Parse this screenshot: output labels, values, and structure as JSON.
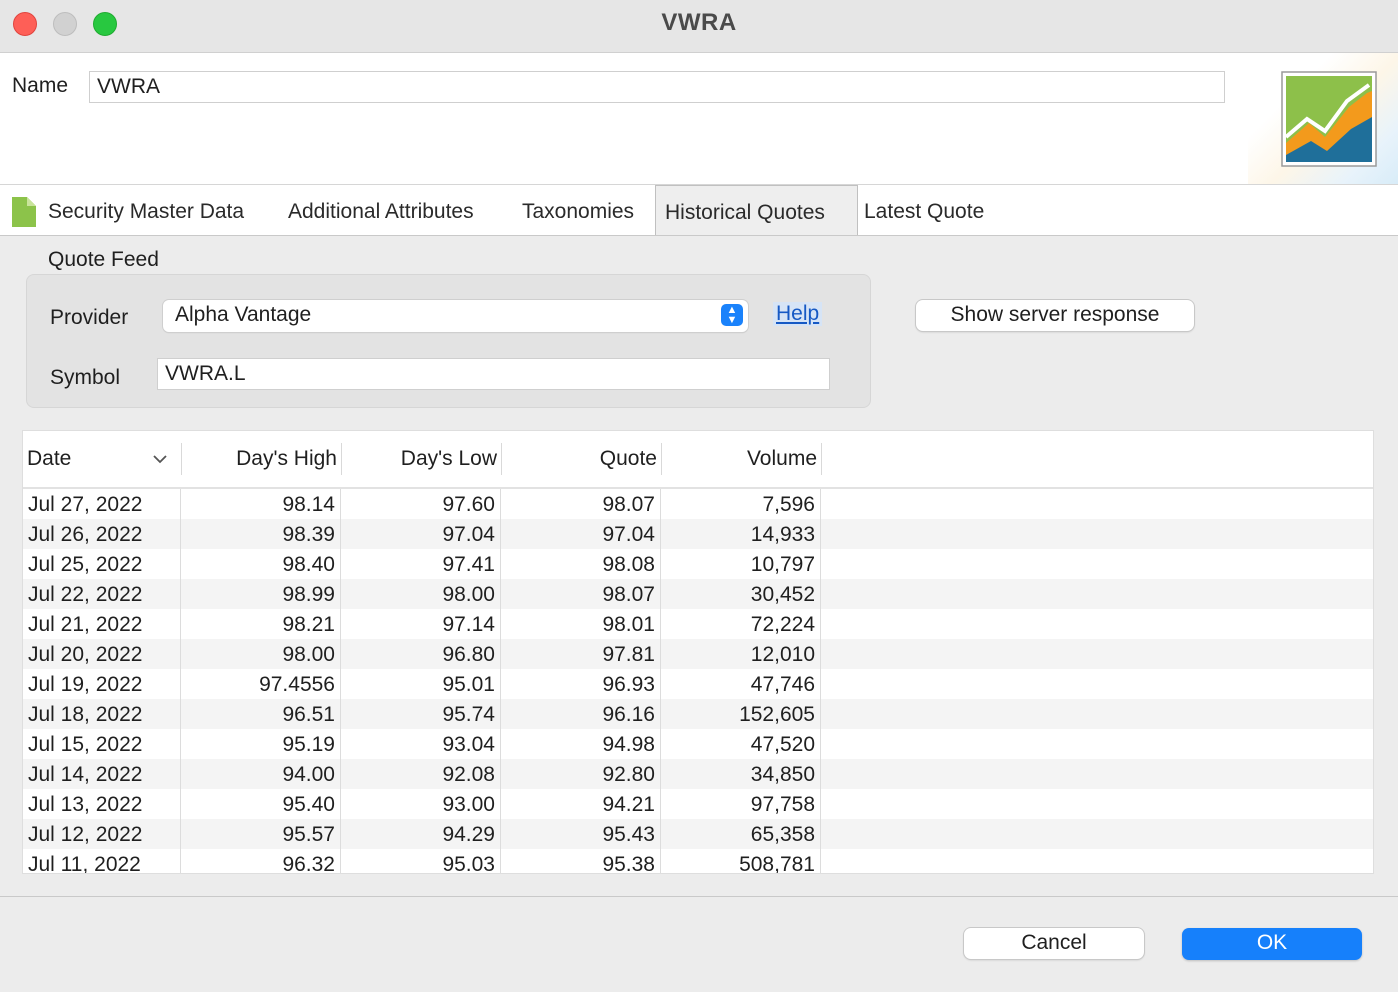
{
  "window": {
    "title": "VWRA",
    "traffic_lights": {
      "close": "#fe5f57",
      "minimize": "#d1d1d1",
      "zoom": "#28c840"
    }
  },
  "header": {
    "name_label": "Name",
    "name_value": "VWRA",
    "logo_icon": "chart-logo-icon"
  },
  "tabs": [
    {
      "label": "Security Master Data",
      "icon": "document-icon",
      "active": false
    },
    {
      "label": "Additional Attributes",
      "active": false
    },
    {
      "label": "Taxonomies",
      "active": false
    },
    {
      "label": "Historical Quotes",
      "active": true
    },
    {
      "label": "Latest Quote",
      "active": false
    }
  ],
  "quote_feed": {
    "title": "Quote Feed",
    "provider_label": "Provider",
    "provider_value": "Alpha Vantage",
    "help_link": "Help",
    "symbol_label": "Symbol",
    "symbol_value": "VWRA.L",
    "show_response_button": "Show server response"
  },
  "table": {
    "columns": [
      "Date",
      "Day's High",
      "Day's Low",
      "Quote",
      "Volume"
    ],
    "rows": [
      [
        "Jul 27, 2022",
        "98.14",
        "97.60",
        "98.07",
        "7,596"
      ],
      [
        "Jul 26, 2022",
        "98.39",
        "97.04",
        "97.04",
        "14,933"
      ],
      [
        "Jul 25, 2022",
        "98.40",
        "97.41",
        "98.08",
        "10,797"
      ],
      [
        "Jul 22, 2022",
        "98.99",
        "98.00",
        "98.07",
        "30,452"
      ],
      [
        "Jul 21, 2022",
        "98.21",
        "97.14",
        "98.01",
        "72,224"
      ],
      [
        "Jul 20, 2022",
        "98.00",
        "96.80",
        "97.81",
        "12,010"
      ],
      [
        "Jul 19, 2022",
        "97.4556",
        "95.01",
        "96.93",
        "47,746"
      ],
      [
        "Jul 18, 2022",
        "96.51",
        "95.74",
        "96.16",
        "152,605"
      ],
      [
        "Jul 15, 2022",
        "95.19",
        "93.04",
        "94.98",
        "47,520"
      ],
      [
        "Jul 14, 2022",
        "94.00",
        "92.08",
        "92.80",
        "34,850"
      ],
      [
        "Jul 13, 2022",
        "95.40",
        "93.00",
        "94.21",
        "97,758"
      ],
      [
        "Jul 12, 2022",
        "95.57",
        "94.29",
        "95.43",
        "65,358"
      ],
      [
        "Jul 11, 2022",
        "96.32",
        "95.03",
        "95.38",
        "508,781"
      ]
    ]
  },
  "footer": {
    "cancel_label": "Cancel",
    "ok_label": "OK",
    "ok_color": "#1680fb"
  }
}
